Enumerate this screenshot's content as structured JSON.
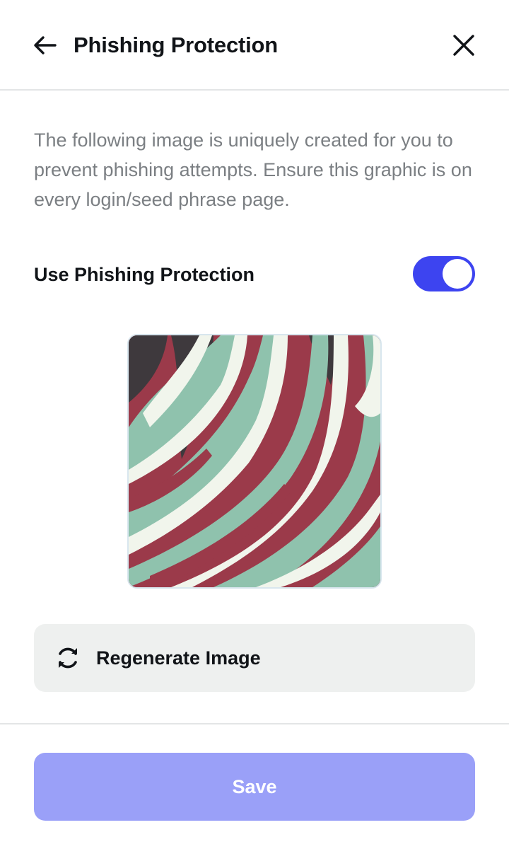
{
  "header": {
    "title": "Phishing Protection",
    "back_icon": "arrow-left-icon",
    "close_icon": "close-icon"
  },
  "description": "The following image is uniquely created for you to prevent phishing attempts. Ensure this graphic is on every login/seed phrase page.",
  "setting": {
    "label": "Use Phishing Protection",
    "enabled": true,
    "on_color": "#3d44f0"
  },
  "security_image": {
    "colors": [
      "#9b3a4a",
      "#8fc2ad",
      "#f1f5ec",
      "#3e393d"
    ]
  },
  "regenerate": {
    "label": "Regenerate Image",
    "icon": "refresh-icon"
  },
  "save": {
    "label": "Save",
    "color": "#9aa0f8"
  }
}
